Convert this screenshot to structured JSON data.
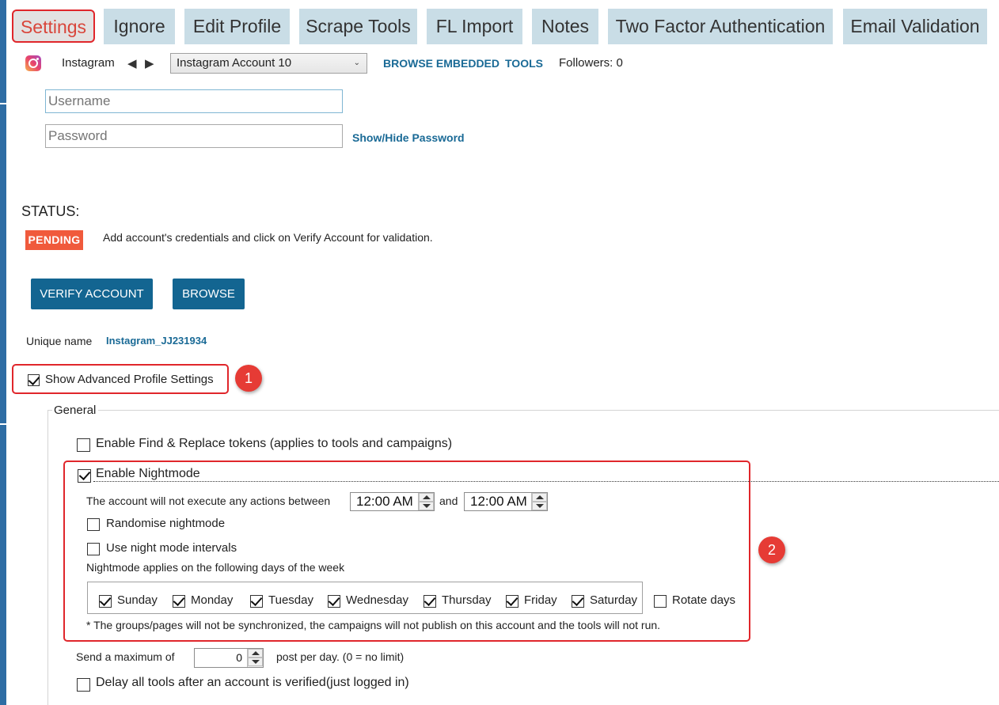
{
  "tabs": [
    {
      "label": "Settings",
      "active": true
    },
    {
      "label": "Ignore"
    },
    {
      "label": "Edit Profile"
    },
    {
      "label": "Scrape Tools"
    },
    {
      "label": "FL Import"
    },
    {
      "label": "Notes"
    },
    {
      "label": "Two Factor Authentication"
    },
    {
      "label": "Email Validation"
    }
  ],
  "account_bar": {
    "network": "Instagram",
    "selected_account": "Instagram Account 10",
    "browse_embedded": "BROWSE EMBEDDED",
    "tools": "TOOLS",
    "followers": "Followers: 0"
  },
  "credentials": {
    "username_placeholder": "Username",
    "password_placeholder": "Password",
    "show_hide": "Show/Hide Password"
  },
  "status": {
    "label": "STATUS:",
    "badge": "PENDING",
    "message": "Add account's credentials and click on Verify Account for validation."
  },
  "buttons": {
    "verify": "VERIFY ACCOUNT",
    "browse": "BROWSE"
  },
  "unique": {
    "label": "Unique name",
    "value": "Instagram_JJ231934"
  },
  "advanced": {
    "label": "Show Advanced Profile Settings",
    "checked": true,
    "marker": "1"
  },
  "general": {
    "legend": "General",
    "find_replace": "Enable Find & Replace tokens (applies to tools and campaigns)",
    "nightmode": {
      "label": "Enable Nightmode",
      "checked": true,
      "between_text": "The account will not execute any actions between",
      "start": "12:00 AM",
      "and_text": "and",
      "end": "12:00 AM",
      "randomise": "Randomise nightmode",
      "intervals": "Use night mode intervals",
      "days_text": "Nightmode applies on the following days of the week",
      "days": [
        {
          "label": "Sunday",
          "checked": true
        },
        {
          "label": "Monday",
          "checked": true
        },
        {
          "label": "Tuesday",
          "checked": true
        },
        {
          "label": "Wednesday",
          "checked": true
        },
        {
          "label": "Thursday",
          "checked": true
        },
        {
          "label": "Friday",
          "checked": true
        },
        {
          "label": "Saturday",
          "checked": true
        }
      ],
      "rotate_days": "Rotate days",
      "note": "* The groups/pages will not be synchronized, the campaigns will not  publish on this account and the tools will not run.",
      "marker": "2"
    },
    "max_send_prefix": "Send a maximum of",
    "max_send_value": "0",
    "max_send_suffix": "post per day. (0 = no limit)",
    "delay_tools": "Delay all tools after an account is verified(just logged in)"
  },
  "colors": {
    "tab_bg": "#c9dde6",
    "accent_blue": "#136591",
    "link_blue": "#1a6a96",
    "pending": "#f05a3c",
    "highlight_red": "#e0262b"
  }
}
